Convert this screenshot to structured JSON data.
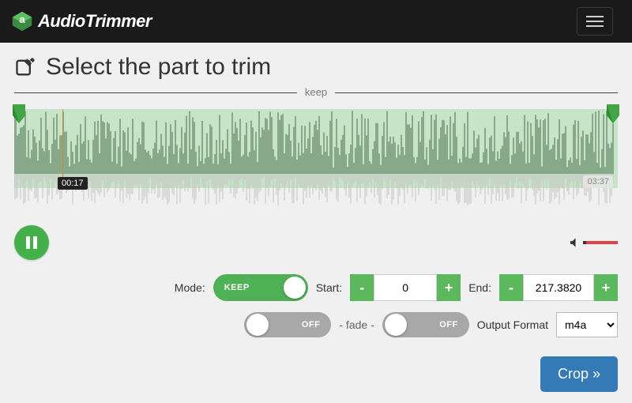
{
  "brand": "AudioTrimmer",
  "heading": "Select the part to trim",
  "keep_label": "keep",
  "time_current": "00:17",
  "time_total": "03:37",
  "mode_label": "Mode:",
  "mode_toggle": "KEEP",
  "start_label": "Start:",
  "start_value": "0",
  "end_label": "End:",
  "end_value": "217.3820",
  "fade_off": "OFF",
  "fade_label": "- fade -",
  "output_label": "Output Format",
  "output_value": "m4a",
  "crop_label": "Crop »",
  "minus": "-",
  "plus": "+"
}
